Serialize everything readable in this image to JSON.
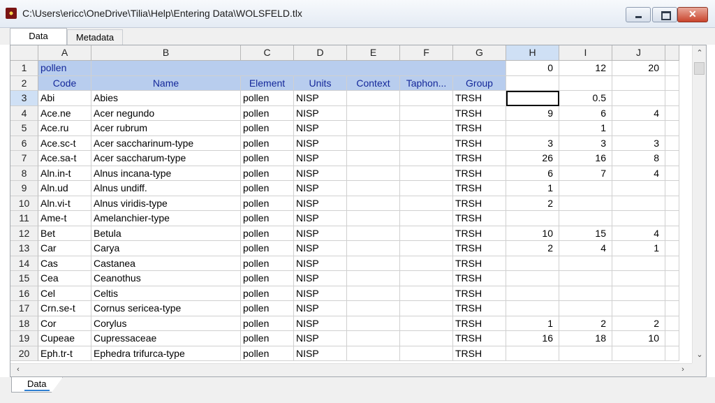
{
  "window": {
    "title": "C:\\Users\\ericc\\OneDrive\\Tilia\\Help\\Entering Data\\WOLSFELD.tlx"
  },
  "tabs": [
    "Data",
    "Metadata"
  ],
  "sheet_tab": "Data",
  "columns": [
    "A",
    "B",
    "C",
    "D",
    "E",
    "F",
    "G",
    "H",
    "I",
    "J"
  ],
  "selected_column": "H",
  "selected_row": 3,
  "rows": [
    {
      "num": "1",
      "kind": "header1",
      "cells": [
        "pollen",
        "",
        "",
        "",
        "",
        "",
        "",
        "0",
        "12",
        "20"
      ]
    },
    {
      "num": "2",
      "kind": "header2",
      "cells": [
        "Code",
        "Name",
        "Element",
        "Units",
        "Context",
        "Taphon...",
        "Group",
        "",
        "",
        ""
      ]
    },
    {
      "num": "3",
      "cells": [
        "Abi",
        "Abies",
        "pollen",
        "NISP",
        "",
        "",
        "TRSH",
        "",
        "0.5",
        ""
      ]
    },
    {
      "num": "4",
      "cells": [
        "Ace.ne",
        "Acer negundo",
        "pollen",
        "NISP",
        "",
        "",
        "TRSH",
        "9",
        "6",
        "4"
      ]
    },
    {
      "num": "5",
      "cells": [
        "Ace.ru",
        "Acer rubrum",
        "pollen",
        "NISP",
        "",
        "",
        "TRSH",
        "",
        "1",
        ""
      ]
    },
    {
      "num": "6",
      "cells": [
        "Ace.sc-t",
        "Acer saccharinum-type",
        "pollen",
        "NISP",
        "",
        "",
        "TRSH",
        "3",
        "3",
        "3"
      ]
    },
    {
      "num": "7",
      "cells": [
        "Ace.sa-t",
        "Acer saccharum-type",
        "pollen",
        "NISP",
        "",
        "",
        "TRSH",
        "26",
        "16",
        "8"
      ]
    },
    {
      "num": "8",
      "cells": [
        "Aln.in-t",
        "Alnus incana-type",
        "pollen",
        "NISP",
        "",
        "",
        "TRSH",
        "6",
        "7",
        "4"
      ]
    },
    {
      "num": "9",
      "cells": [
        "Aln.ud",
        "Alnus undiff.",
        "pollen",
        "NISP",
        "",
        "",
        "TRSH",
        "1",
        "",
        ""
      ]
    },
    {
      "num": "10",
      "cells": [
        "Aln.vi-t",
        "Alnus viridis-type",
        "pollen",
        "NISP",
        "",
        "",
        "TRSH",
        "2",
        "",
        ""
      ]
    },
    {
      "num": "11",
      "cells": [
        "Ame-t",
        "Amelanchier-type",
        "pollen",
        "NISP",
        "",
        "",
        "TRSH",
        "",
        "",
        ""
      ]
    },
    {
      "num": "12",
      "cells": [
        "Bet",
        "Betula",
        "pollen",
        "NISP",
        "",
        "",
        "TRSH",
        "10",
        "15",
        "4"
      ]
    },
    {
      "num": "13",
      "cells": [
        "Car",
        "Carya",
        "pollen",
        "NISP",
        "",
        "",
        "TRSH",
        "2",
        "4",
        "1"
      ]
    },
    {
      "num": "14",
      "cells": [
        "Cas",
        "Castanea",
        "pollen",
        "NISP",
        "",
        "",
        "TRSH",
        "",
        "",
        ""
      ]
    },
    {
      "num": "15",
      "cells": [
        "Cea",
        "Ceanothus",
        "pollen",
        "NISP",
        "",
        "",
        "TRSH",
        "",
        "",
        ""
      ]
    },
    {
      "num": "16",
      "cells": [
        "Cel",
        "Celtis",
        "pollen",
        "NISP",
        "",
        "",
        "TRSH",
        "",
        "",
        ""
      ]
    },
    {
      "num": "17",
      "cells": [
        "Crn.se-t",
        "Cornus sericea-type",
        "pollen",
        "NISP",
        "",
        "",
        "TRSH",
        "",
        "",
        ""
      ]
    },
    {
      "num": "18",
      "cells": [
        "Cor",
        "Corylus",
        "pollen",
        "NISP",
        "",
        "",
        "TRSH",
        "1",
        "2",
        "2"
      ]
    },
    {
      "num": "19",
      "cells": [
        "Cupeae",
        "Cupressaceae",
        "pollen",
        "NISP",
        "",
        "",
        "TRSH",
        "16",
        "18",
        "10"
      ]
    },
    {
      "num": "20",
      "cells": [
        "Eph.tr-t",
        "Ephedra trifurca-type",
        "pollen",
        "NISP",
        "",
        "",
        "TRSH",
        "",
        "",
        ""
      ]
    }
  ],
  "colors": {
    "header_fill": "#b8cdee",
    "header_text": "#14289a",
    "selection_header": "#cfe0f5"
  },
  "icons": {
    "scroll_up": "chevron-up-icon",
    "scroll_down": "chevron-down-icon",
    "scroll_left": "chevron-left-icon",
    "scroll_right": "chevron-right-icon"
  }
}
